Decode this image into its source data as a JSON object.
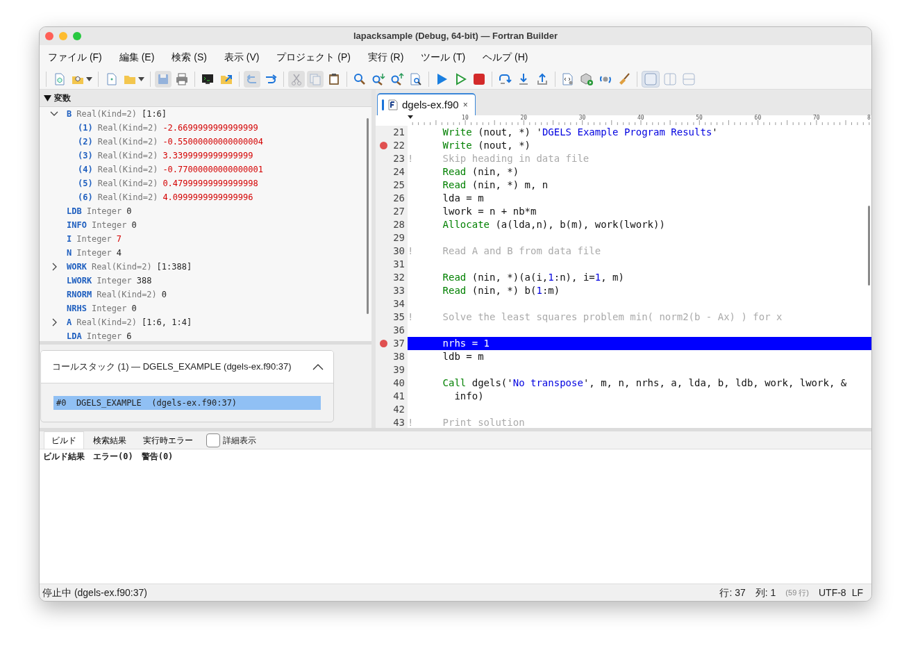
{
  "window": {
    "title": "lapacksample (Debug, 64-bit) — Fortran Builder"
  },
  "menu": [
    "ファイル (F)",
    "編集 (E)",
    "検索 (S)",
    "表示 (V)",
    "プロジェクト (P)",
    "実行 (R)",
    "ツール (T)",
    "ヘルプ (H)"
  ],
  "toolbar": [
    {
      "kind": "separator"
    },
    {
      "kind": "button",
      "disabled": false
    },
    {
      "kind": "dropdown",
      "disabled": false
    },
    {
      "kind": "separator"
    },
    {
      "kind": "button",
      "disabled": false
    },
    {
      "kind": "dropdown",
      "disabled": false
    },
    {
      "kind": "separator"
    },
    {
      "kind": "button",
      "disabled": true
    },
    {
      "kind": "button",
      "disabled": false
    },
    {
      "kind": "separator"
    },
    {
      "kind": "button",
      "disabled": false
    },
    {
      "kind": "button",
      "disabled": false
    },
    {
      "kind": "separator"
    },
    {
      "kind": "button",
      "disabled": true
    },
    {
      "kind": "button",
      "disabled": false
    },
    {
      "kind": "separator"
    },
    {
      "kind": "button",
      "disabled": true
    },
    {
      "kind": "button",
      "disabled": true
    },
    {
      "kind": "button",
      "disabled": false
    },
    {
      "kind": "separator"
    },
    {
      "kind": "button",
      "disabled": false
    },
    {
      "kind": "button",
      "disabled": false
    },
    {
      "kind": "button",
      "disabled": false
    },
    {
      "kind": "button",
      "disabled": false
    },
    {
      "kind": "separator"
    },
    {
      "kind": "button",
      "disabled": false
    },
    {
      "kind": "button",
      "disabled": false
    },
    {
      "kind": "button",
      "disabled": false
    },
    {
      "kind": "separator"
    },
    {
      "kind": "button",
      "disabled": false
    },
    {
      "kind": "button",
      "disabled": false
    },
    {
      "kind": "button",
      "disabled": false
    },
    {
      "kind": "separator"
    },
    {
      "kind": "button",
      "disabled": false
    },
    {
      "kind": "button",
      "disabled": false
    },
    {
      "kind": "button",
      "disabled": false
    },
    {
      "kind": "button",
      "disabled": false
    },
    {
      "kind": "separator"
    },
    {
      "kind": "toggle",
      "selected": true
    },
    {
      "kind": "toggle",
      "selected": false
    },
    {
      "kind": "toggle",
      "selected": false
    }
  ],
  "variables": {
    "title": "変数",
    "expanded": true,
    "items": [
      {
        "name": "B",
        "type": "Real(Kind=2)",
        "value": "[1:6]",
        "changed": false,
        "expanded": true,
        "children": [
          {
            "name": "(1)",
            "type": "Real(Kind=2)",
            "value": "-2.6699999999999999",
            "changed": true
          },
          {
            "name": "(2)",
            "type": "Real(Kind=2)",
            "value": "-0.55000000000000004",
            "changed": true
          },
          {
            "name": "(3)",
            "type": "Real(Kind=2)",
            "value": "3.3399999999999999",
            "changed": true
          },
          {
            "name": "(4)",
            "type": "Real(Kind=2)",
            "value": "-0.77000000000000001",
            "changed": true
          },
          {
            "name": "(5)",
            "type": "Real(Kind=2)",
            "value": "0.47999999999999998",
            "changed": true
          },
          {
            "name": "(6)",
            "type": "Real(Kind=2)",
            "value": "4.0999999999999996",
            "changed": true
          }
        ]
      },
      {
        "name": "LDB",
        "type": "Integer",
        "value": "0",
        "changed": false
      },
      {
        "name": "INFO",
        "type": "Integer",
        "value": "0",
        "changed": false
      },
      {
        "name": "I",
        "type": "Integer",
        "value": "7",
        "changed": true
      },
      {
        "name": "N",
        "type": "Integer",
        "value": "4",
        "changed": false
      },
      {
        "name": "WORK",
        "type": "Real(Kind=2)",
        "value": "[1:388]",
        "changed": false,
        "expanded": false
      },
      {
        "name": "LWORK",
        "type": "Integer",
        "value": "388",
        "changed": false
      },
      {
        "name": "RNORM",
        "type": "Real(Kind=2)",
        "value": "0",
        "changed": false
      },
      {
        "name": "NRHS",
        "type": "Integer",
        "value": "0",
        "changed": false
      },
      {
        "name": "A",
        "type": "Real(Kind=2)",
        "value": "[1:6, 1:4]",
        "changed": false,
        "expanded": false
      },
      {
        "name": "LDA",
        "type": "Integer",
        "value": "6",
        "changed": false
      }
    ]
  },
  "call_stack": {
    "title": "コールスタック (1) — DGELS_EXAMPLE (dgels-ex.f90:37)",
    "expanded": true,
    "frames": [
      {
        "text": "#0  DGELS_EXAMPLE  (dgels-ex.f90:37)",
        "selected": true
      }
    ]
  },
  "editor": {
    "tabs": [
      {
        "label": "dgels-ex.f90",
        "close": "×",
        "selected": true
      }
    ],
    "ruler": [
      "10",
      "20",
      "30",
      "40",
      "50",
      "60",
      "70",
      "8"
    ],
    "lines": [
      {
        "number": "21",
        "breakpoint": false,
        "current": false,
        "tokens": [
          {
            "kind": "keyword",
            "text": "Write"
          },
          {
            "kind": "plain",
            "text": " (nout, *) '"
          },
          {
            "kind": "string",
            "text": "DGELS Example Program Results"
          },
          {
            "kind": "plain",
            "text": "'"
          }
        ]
      },
      {
        "number": "22",
        "breakpoint": true,
        "current": false,
        "tokens": [
          {
            "kind": "keyword",
            "text": "Write"
          },
          {
            "kind": "plain",
            "text": " (nout, *)"
          }
        ]
      },
      {
        "number": "23",
        "breakpoint": false,
        "current": false,
        "marker": "!",
        "tokens": [
          {
            "kind": "comment",
            "text": "Skip heading in data file"
          }
        ]
      },
      {
        "number": "24",
        "breakpoint": false,
        "current": false,
        "tokens": [
          {
            "kind": "keyword",
            "text": "Read"
          },
          {
            "kind": "plain",
            "text": " (nin, *)"
          }
        ]
      },
      {
        "number": "25",
        "breakpoint": false,
        "current": false,
        "tokens": [
          {
            "kind": "keyword",
            "text": "Read"
          },
          {
            "kind": "plain",
            "text": " (nin, *) m, n"
          }
        ]
      },
      {
        "number": "26",
        "breakpoint": false,
        "current": false,
        "tokens": [
          {
            "kind": "plain",
            "text": "lda = m"
          }
        ]
      },
      {
        "number": "27",
        "breakpoint": false,
        "current": false,
        "tokens": [
          {
            "kind": "plain",
            "text": "lwork = n + nb*m"
          }
        ]
      },
      {
        "number": "28",
        "breakpoint": false,
        "current": false,
        "tokens": [
          {
            "kind": "keyword",
            "text": "Allocate"
          },
          {
            "kind": "plain",
            "text": " (a(lda,n), b(m), work(lwork))"
          }
        ]
      },
      {
        "number": "29",
        "breakpoint": false,
        "current": false
      },
      {
        "number": "30",
        "breakpoint": false,
        "current": false,
        "marker": "!",
        "tokens": [
          {
            "kind": "comment",
            "text": "Read A and B from data file"
          }
        ]
      },
      {
        "number": "31",
        "breakpoint": false,
        "current": false
      },
      {
        "number": "32",
        "breakpoint": false,
        "current": false,
        "tokens": [
          {
            "kind": "keyword",
            "text": "Read"
          },
          {
            "kind": "plain",
            "text": " (nin, *)(a(i,"
          },
          {
            "kind": "number",
            "text": "1"
          },
          {
            "kind": "plain",
            "text": ":n), i="
          },
          {
            "kind": "number",
            "text": "1"
          },
          {
            "kind": "plain",
            "text": ", m)"
          }
        ]
      },
      {
        "number": "33",
        "breakpoint": false,
        "current": false,
        "tokens": [
          {
            "kind": "keyword",
            "text": "Read"
          },
          {
            "kind": "plain",
            "text": " (nin, *) b("
          },
          {
            "kind": "number",
            "text": "1"
          },
          {
            "kind": "plain",
            "text": ":m)"
          }
        ]
      },
      {
        "number": "34",
        "breakpoint": false,
        "current": false
      },
      {
        "number": "35",
        "breakpoint": false,
        "current": false,
        "marker": "!",
        "tokens": [
          {
            "kind": "comment",
            "text": "Solve the least squares problem min( norm2(b - Ax) ) for x"
          }
        ]
      },
      {
        "number": "36",
        "breakpoint": false,
        "current": false
      },
      {
        "number": "37",
        "breakpoint": true,
        "current": true,
        "tokens": [
          {
            "kind": "plain",
            "text": "nrhs = "
          },
          {
            "kind": "number",
            "text": "1"
          }
        ]
      },
      {
        "number": "38",
        "breakpoint": false,
        "current": false,
        "tokens": [
          {
            "kind": "plain",
            "text": "ldb = m"
          }
        ]
      },
      {
        "number": "39",
        "breakpoint": false,
        "current": false
      },
      {
        "number": "40",
        "breakpoint": false,
        "current": false,
        "tokens": [
          {
            "kind": "keyword",
            "text": "Call"
          },
          {
            "kind": "plain",
            "text": " dgels('"
          },
          {
            "kind": "string",
            "text": "No transpose"
          },
          {
            "kind": "plain",
            "text": "', m, n, nrhs, a, lda, b, ldb, work, lwork, &"
          }
        ]
      },
      {
        "number": "41",
        "breakpoint": false,
        "current": false,
        "tokens": [
          {
            "kind": "plain",
            "text": "  info)"
          }
        ]
      },
      {
        "number": "42",
        "breakpoint": false,
        "current": false
      },
      {
        "number": "43",
        "breakpoint": false,
        "current": false,
        "marker": "!",
        "tokens": [
          {
            "kind": "comment",
            "text": "Print solution"
          }
        ]
      }
    ]
  },
  "output": {
    "tabs": [
      {
        "label": "ビルド",
        "selected": true
      },
      {
        "label": "検索結果",
        "selected": false
      },
      {
        "label": "実行時エラー",
        "selected": false
      }
    ],
    "verbose": {
      "label": "詳細表示",
      "checked": false
    },
    "text": "ビルド結果　エラー(0)　警告(0)"
  },
  "status_bar": {
    "state": "停止中 (dgels-ex.f90:37)",
    "line": "行: 37",
    "column": "列: 1",
    "total": "(59 行)",
    "encoding": "UTF-8",
    "line_ending": "LF"
  }
}
